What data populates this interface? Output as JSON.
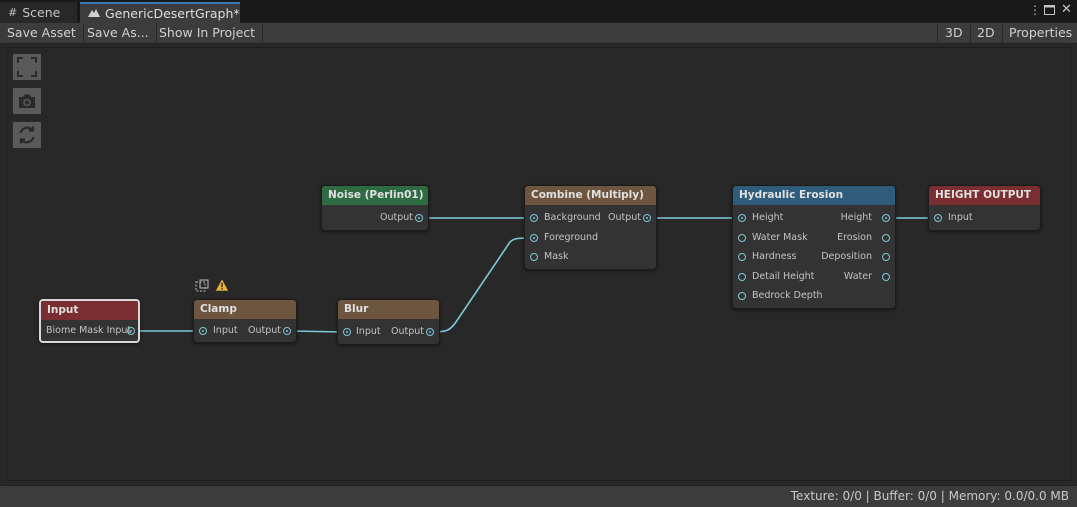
{
  "tabs": [
    {
      "label": "Scene",
      "icon": "grid-icon"
    },
    {
      "label": "GenericDesertGraph*",
      "icon": "terrain-icon"
    }
  ],
  "toolbar": {
    "save_asset": "Save Asset",
    "save_as": "Save As...",
    "show_in_project": "Show In Project",
    "view_3d": "3D",
    "view_2d": "2D",
    "properties": "Properties"
  },
  "nodes": {
    "input": {
      "title": "Input",
      "header_color": "#7a2e31",
      "ports": {
        "biome_mask_input": "Biome Mask Input"
      }
    },
    "clamp": {
      "title": "Clamp",
      "header_color": "#6e5540",
      "ports": {
        "input": "Input",
        "output": "Output"
      }
    },
    "blur": {
      "title": "Blur",
      "header_color": "#6e5540",
      "ports": {
        "input": "Input",
        "output": "Output"
      }
    },
    "noise": {
      "title": "Noise (Perlin01)",
      "header_color": "#2e6b43",
      "ports": {
        "output": "Output"
      }
    },
    "combine": {
      "title": "Combine (Multiply)",
      "header_color": "#6e5540",
      "ports": {
        "background": "Background",
        "foreground": "Foreground",
        "mask": "Mask",
        "output": "Output"
      }
    },
    "erosion": {
      "title": "Hydraulic Erosion",
      "header_color": "#2f5c7a",
      "ports": {
        "height_in": "Height",
        "water_mask": "Water Mask",
        "hardness": "Hardness",
        "detail_height": "Detail Height",
        "bedrock_depth": "Bedrock Depth",
        "height_out": "Height",
        "erosion": "Erosion",
        "deposition": "Deposition",
        "water": "Water"
      }
    },
    "height_output": {
      "title": "HEIGHT OUTPUT",
      "header_color": "#7a2e31",
      "ports": {
        "input": "Input"
      }
    }
  },
  "status": {
    "text": "Texture: 0/0 | Buffer: 0/0 | Memory: 0.0/0.0 MB"
  },
  "colors": {
    "wire": "#7ec8da",
    "tab_accent": "#3a79bb",
    "warning": "#e8b33a"
  }
}
